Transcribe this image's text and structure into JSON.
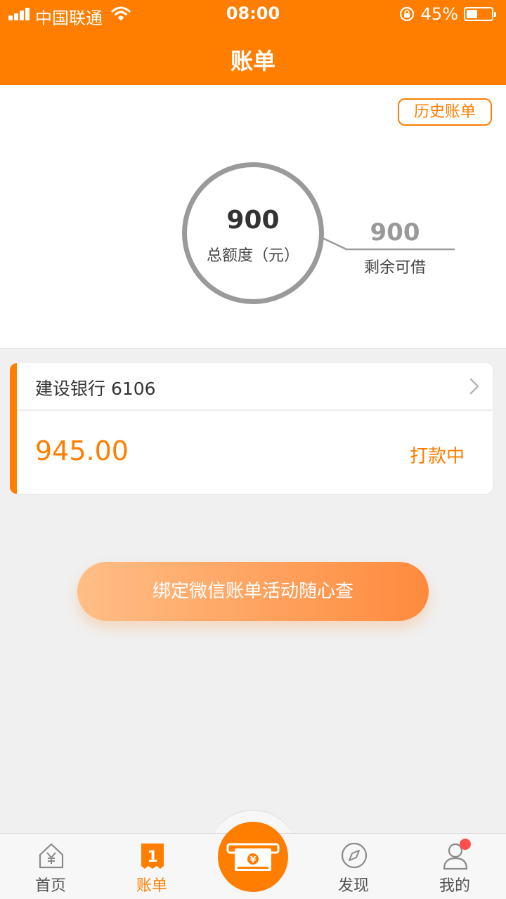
{
  "status_bar": {
    "carrier": "中国联通",
    "time": "08:00",
    "battery_percent": "45%",
    "battery_level": 0.45
  },
  "nav": {
    "title": "账单"
  },
  "summary": {
    "history_button": "历史账单",
    "total_amount": "900",
    "total_label": "总额度（元）",
    "remaining_amount": "900",
    "remaining_label": "剩余可借"
  },
  "bill_card": {
    "bank": "建设银行 6106",
    "amount": "945.00",
    "status": "打款中"
  },
  "bind_button": "绑定微信账单活动随心查",
  "tabbar": {
    "items": [
      {
        "label": "首页",
        "icon": "home-yen-icon",
        "active": false
      },
      {
        "label": "账单",
        "icon": "bill-icon",
        "active": true
      },
      {
        "label": "",
        "icon": "cash-withdraw-icon",
        "active": false
      },
      {
        "label": "发现",
        "icon": "compass-icon",
        "active": false
      },
      {
        "label": "我的",
        "icon": "user-icon",
        "active": false,
        "badge": true
      }
    ]
  },
  "colors": {
    "brand": "#ff7e00",
    "badge": "#ff4d4d"
  }
}
